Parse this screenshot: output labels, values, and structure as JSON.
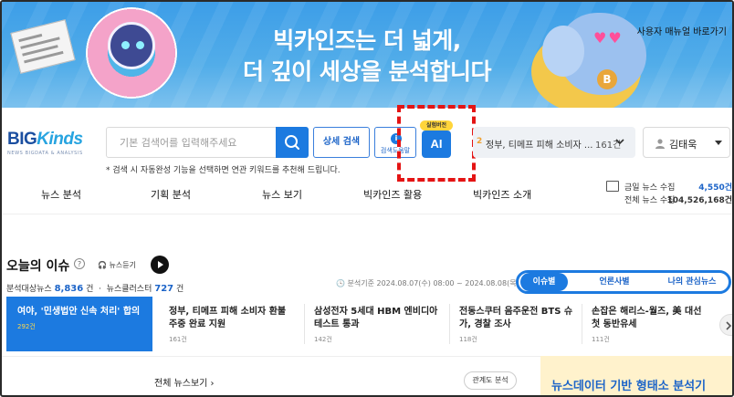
{
  "banner": {
    "headline_line1": "빅카인즈는 더 넓게,",
    "headline_line2": "더 깊이 세상을 분석합니다",
    "manual_link": "사용자 매뉴얼 바로가기",
    "coin_letter": "B"
  },
  "logo": {
    "big": "BIG",
    "kinds": "Kinds",
    "sub": "NEWS BIGDATA & ANALYSIS"
  },
  "search": {
    "placeholder": "기본 검색어를 입력해주세요",
    "value": "",
    "detail_button": "상세 검색",
    "guide_button": "검색도움말",
    "ai_button": "AI",
    "beta_badge": "실험버전",
    "hint": "* 검색 시 자동완성 기능을 선택하면 연관 키워드를 추천해 드립니다."
  },
  "issue_select": {
    "rank": "2",
    "text": "정부, 티메프 피해 소비자 ...",
    "count": "161건"
  },
  "user": {
    "name": "김태욱"
  },
  "nav": {
    "items": [
      "뉴스 분석",
      "기획 분석",
      "뉴스 보기",
      "빅카인즈 활용",
      "빅카인즈 소개"
    ]
  },
  "stats": {
    "today_label": "금일 뉴스 수집",
    "today_value": "4,550건",
    "total_label": "전체 뉴스 수집",
    "total_value": "104,526,168건"
  },
  "today": {
    "title": "오늘의 이슈",
    "help": "?",
    "listen": "뉴스듣기",
    "target_label": "분석대상뉴스",
    "target_value": "8,836",
    "target_unit": "건",
    "cluster_label": "뉴스클러스터",
    "cluster_value": "727",
    "cluster_unit": "건",
    "period": "분석기준 2024.08.07(수) 08:00 ~ 2024.08.08(목) 08:00",
    "tabs": [
      "이슈별",
      "언론사별",
      "나의 관심뉴스"
    ]
  },
  "cards": [
    {
      "title": "여야, '민생법안 신속 처리' 합의",
      "count": "292건"
    },
    {
      "title": "정부, 티메프 피해 소비자 환불 주중 완료 지원",
      "count": "161건"
    },
    {
      "title": "삼성전자 5세대 HBM 엔비디아 테스트 통과",
      "count": "142건"
    },
    {
      "title": "전동스쿠터 음주운전 BTS 슈가, 경찰 조사",
      "count": "118건"
    },
    {
      "title": "손잡은 해리스-월즈, 美 대선 첫 동반유세",
      "count": "111건"
    }
  ],
  "bottom": {
    "news_all": "전체 뉴스보기 ›",
    "keyword_button": "관계도 분석",
    "morph_title": "뉴스데이터 기반 형태소 분석기"
  },
  "colors": {
    "primary": "#1c7ae0",
    "highlight": "#e41414",
    "badge": "#ffd53b"
  }
}
